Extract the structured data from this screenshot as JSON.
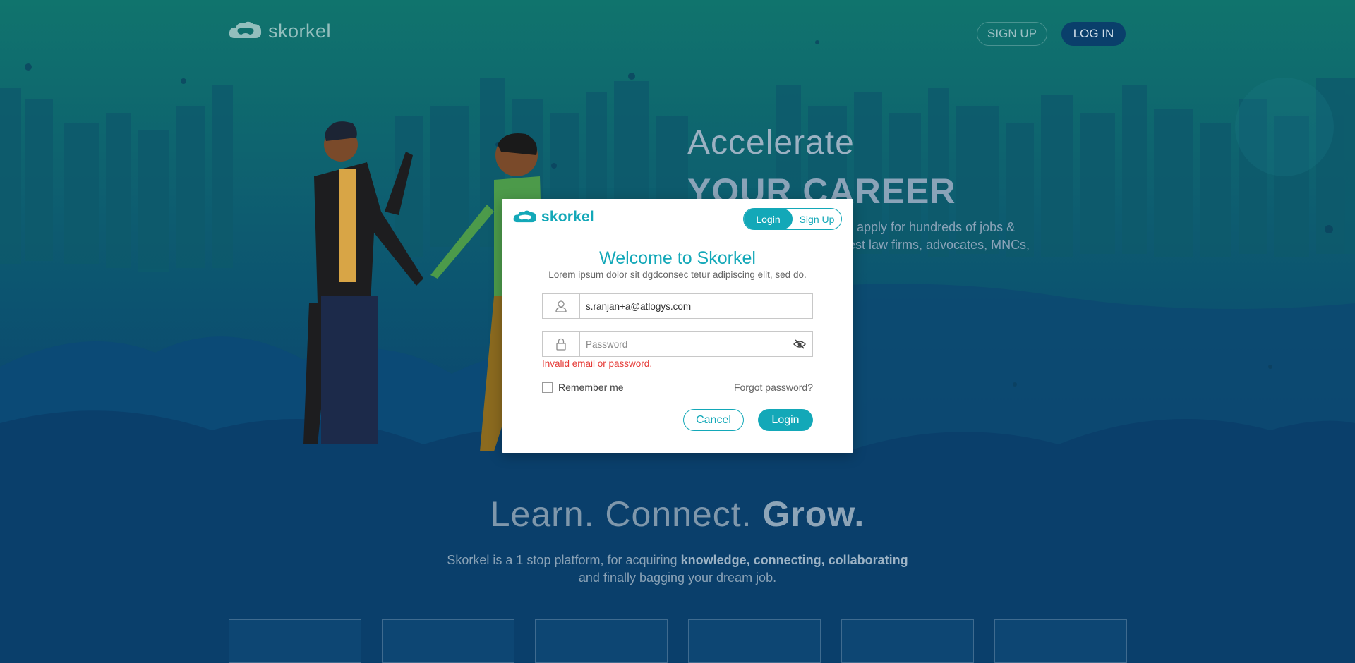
{
  "nav": {
    "logo_text": "skorkel",
    "signup_label": "SIGN UP",
    "login_label": "LOG IN"
  },
  "hero": {
    "title": "Accelerate",
    "subtitle": "YOUR CAREER",
    "desc_line1": "apply for hundreds of jobs &",
    "desc_line2": "est law firms, advocates, MNCs,"
  },
  "section": {
    "tagline_part1": "Learn. Connect.",
    "tagline_part2": "Grow.",
    "desc_a": "Skorkel is a 1 stop platform, for acquiring",
    "desc_b": "knowledge, connecting, collaborating",
    "desc_c": "and finally bagging your dream job."
  },
  "modal": {
    "logo_text": "skorkel",
    "tab_login": "Login",
    "tab_signup": "Sign Up",
    "title": "Welcome to Skorkel",
    "subtitle": "Lorem ipsum dolor sit dgdconsec tetur adipiscing elit, sed do.",
    "email_value": "s.ranjan+a@atlogys.com",
    "password_placeholder": "Password",
    "error": "Invalid email or password.",
    "remember_label": "Remember me",
    "forgot_label": "Forgot password?",
    "cancel_label": "Cancel",
    "submit_label": "Login"
  },
  "colors": {
    "accent": "#13a8b8",
    "error": "#e53935",
    "background_top": "#0f6e6c",
    "background_bottom": "#0a3f6b"
  }
}
